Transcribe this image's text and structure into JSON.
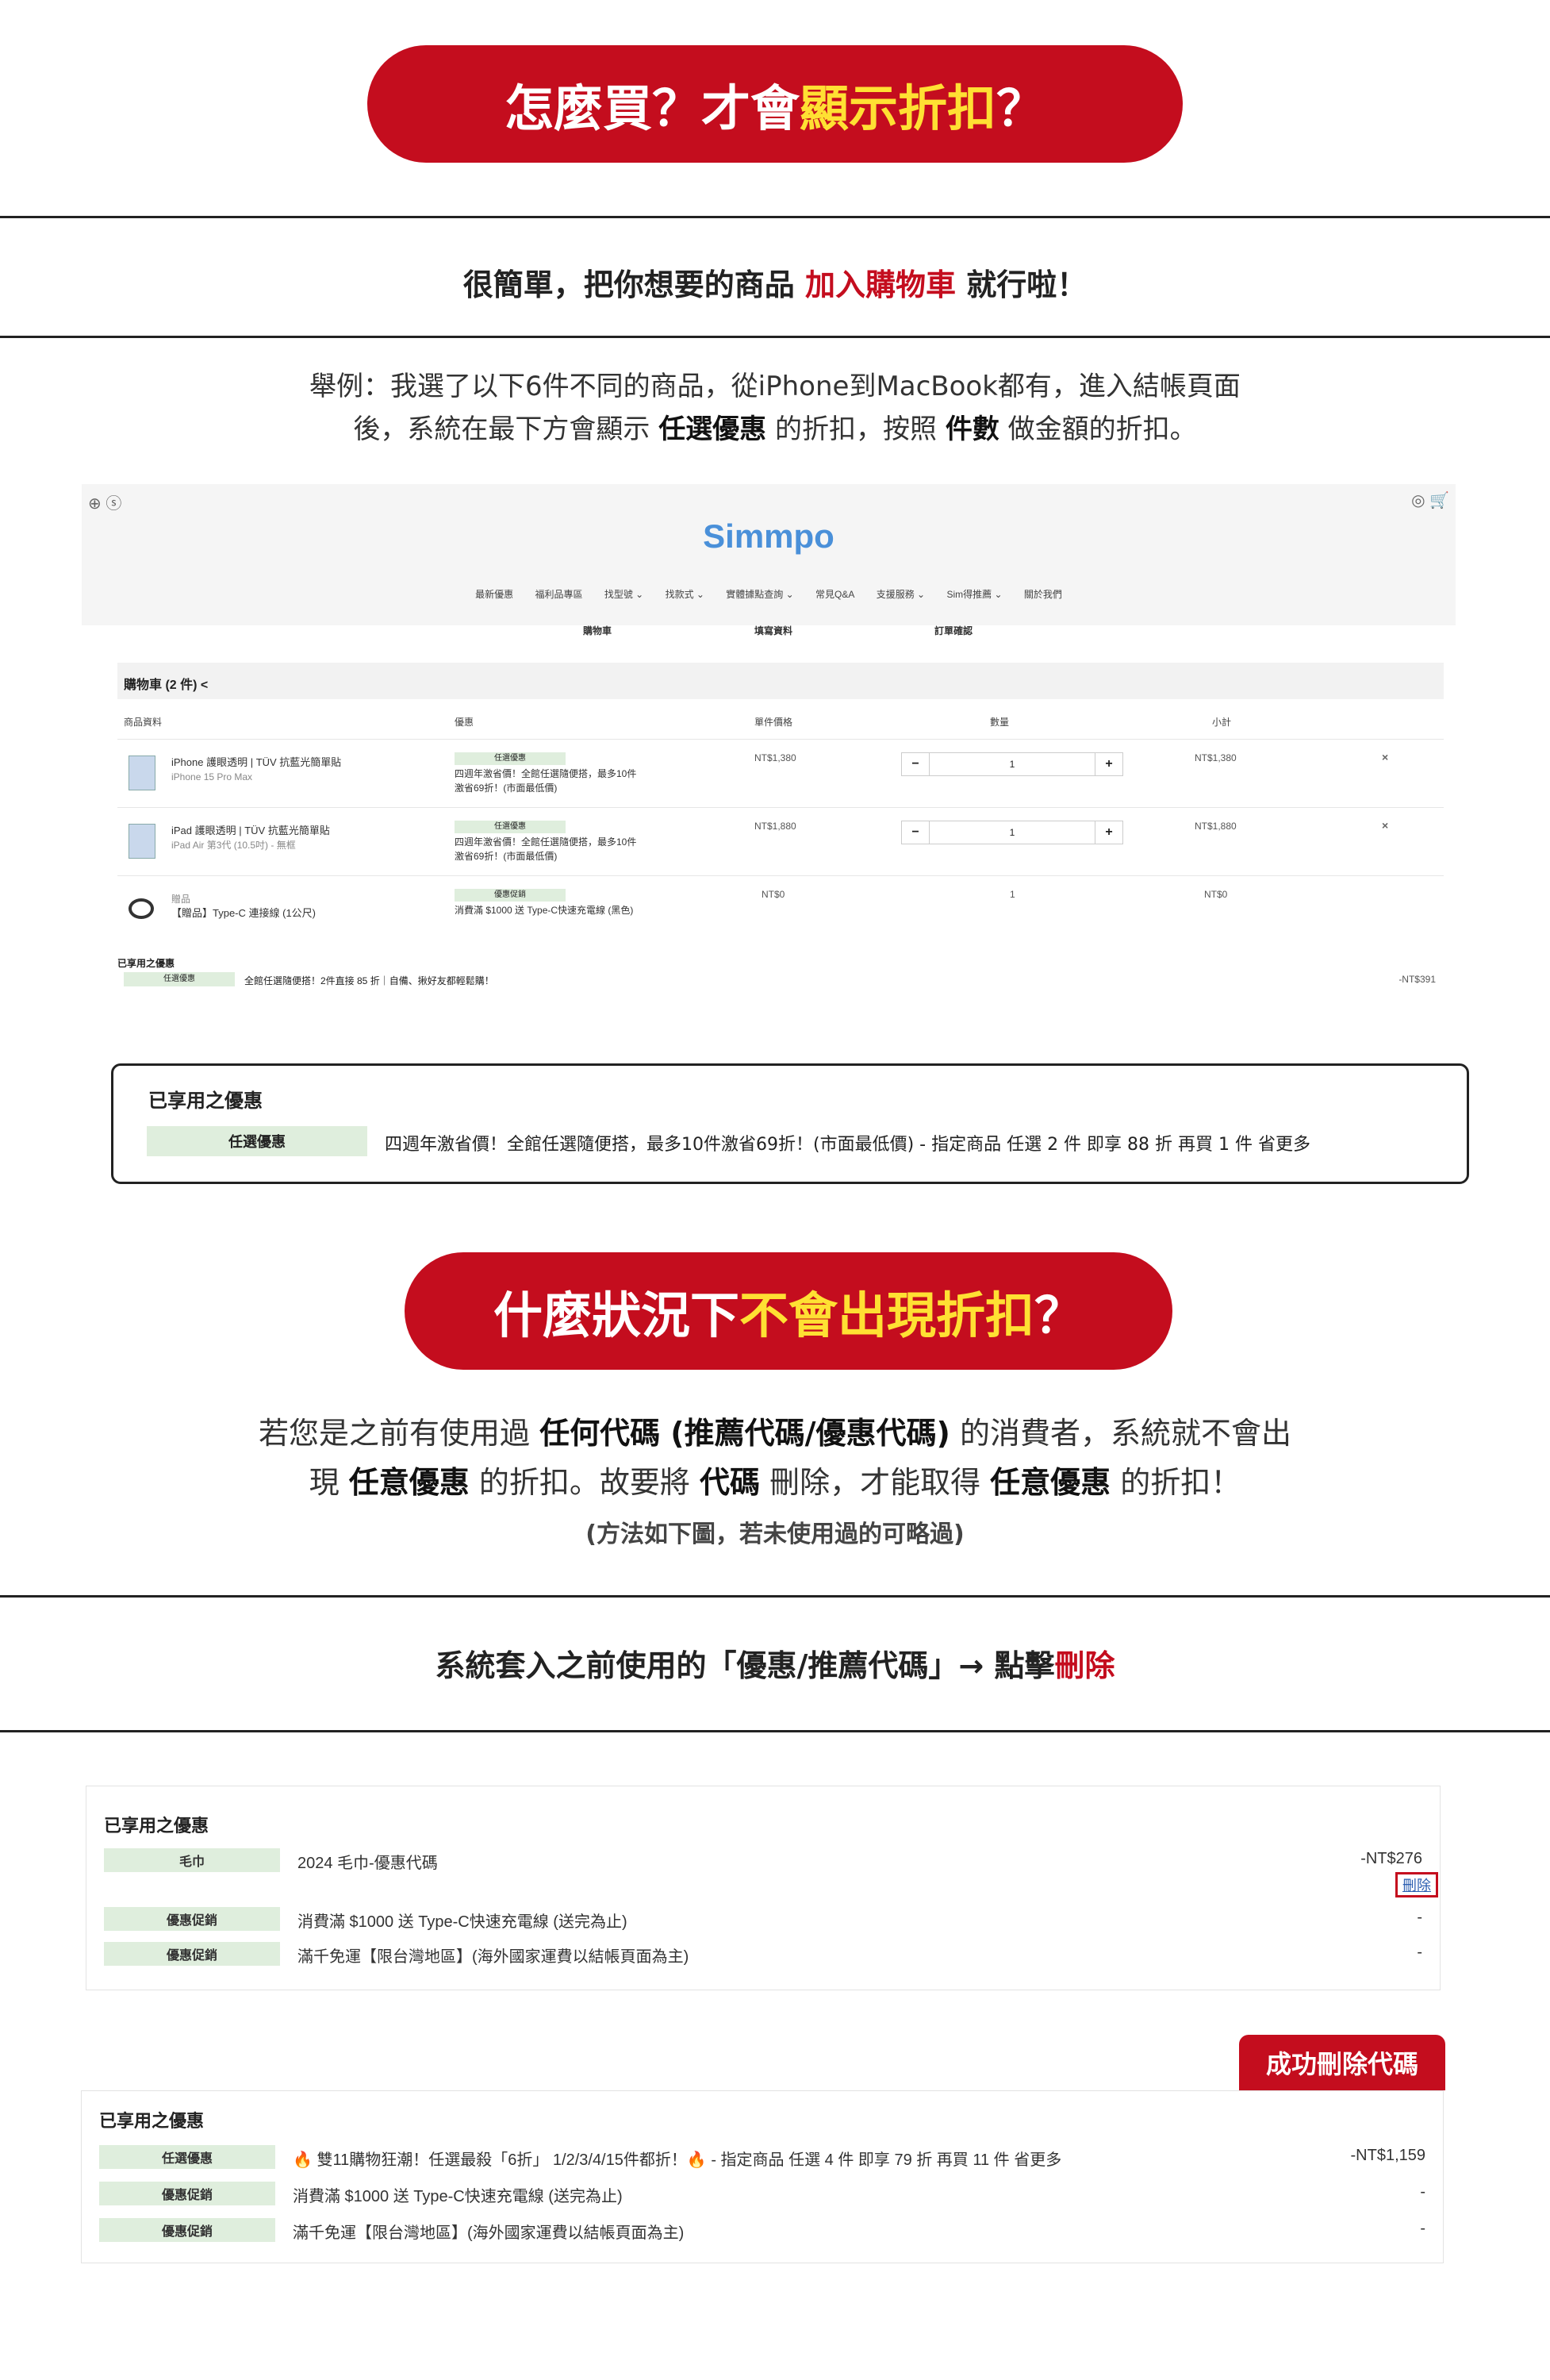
{
  "section1": {
    "pill_text": "怎麼買？才會 ",
    "pill_highlight": "顯示折扣",
    "pill_end": "？",
    "subtitle_prefix": "很簡單，把你想要的商品 ",
    "subtitle_red": "加入購物車",
    "subtitle_suffix": " 就行啦！",
    "para_line1": "舉例：我選了以下6件不同的商品，從iPhone到MacBook都有，進入結帳頁面",
    "para_line2_a": "後，系統在最下方會顯示 ",
    "para_line2_b": "任選優惠",
    "para_line2_c": " 的折扣，按照 ",
    "para_line2_d": "件數",
    "para_line2_e": " 做金額的折扣。"
  },
  "shot1": {
    "logo": "Simmpo",
    "nav": [
      "最新優惠",
      "福利品專區",
      "找型號 ⌄",
      "找款式 ⌄",
      "實體據點查詢 ⌄",
      "常見Q&A",
      "支援服務 ⌄",
      "Sim得推薦 ⌄",
      "關於我們"
    ],
    "steps": [
      "購物車",
      "填寫資料",
      "訂單確認"
    ],
    "cart_title": "購物車  (2 件)  <",
    "col_headers": [
      "商品資料",
      "優惠",
      "單件價格",
      "數量",
      "小計"
    ],
    "rows": [
      {
        "name": "iPhone 護眼透明 | TÜV 抗藍光簡單貼",
        "sub": "iPhone 15 Pro Max",
        "tag": "任選優惠",
        "promo1": "四週年激省價！全館任選隨便搭，最多10件",
        "promo2": "激省69折！(市面最低價)",
        "price": "NT$1,380",
        "qty": "1",
        "subtotal": "NT$1,380",
        "minus": "−",
        "plus": "+",
        "remove": "×"
      },
      {
        "name": "iPad 護眼透明 | TÜV 抗藍光簡單貼",
        "sub": "iPad Air 第3代 (10.5吋) - 無框",
        "tag": "任選優惠",
        "promo1": "四週年激省價！全館任選隨便搭，最多10件",
        "promo2": "激省69折！(市面最低價)",
        "price": "NT$1,880",
        "qty": "1",
        "subtotal": "NT$1,880",
        "minus": "−",
        "plus": "+",
        "remove": "×"
      },
      {
        "name": "【贈品】Type-C 連接線 (1公尺)",
        "sub": "贈品",
        "tag": "優惠促銷",
        "promo1": "消費滿 $1000 送 Type-C快速充電線 (黑色)",
        "promo2": "",
        "price": "NT$0",
        "qty": "1",
        "subtotal": "NT$0"
      }
    ],
    "used_title": "已享用之優惠",
    "used_tag": "任選優惠",
    "used_text": "全館任選隨便搭！2件直接 85 折｜自備、揪好友都輕鬆購！",
    "used_amount": "-NT$391"
  },
  "box": {
    "title": "已享用之優惠",
    "tag": "任選優惠",
    "desc": "四週年激省價！全館任選隨便搭，最多10件激省69折！(市面最低價) - 指定商品 任選 2 件 即享 88 折 再買 1 件 省更多"
  },
  "section2": {
    "pill_text": "什麼狀況下 ",
    "pill_highlight": "不會出現折扣",
    "pill_end": "？",
    "para1_a": "若您是之前有使用過 ",
    "para1_b": "任何代碼 (推薦代碼/優惠代碼)",
    "para1_c": " 的消費者，系統就不會出",
    "para2_a": "現 ",
    "para2_b": "任意優惠",
    "para2_c": " 的折扣。故要將 ",
    "para2_d": "代碼",
    "para2_e": " 刪除，才能取得 ",
    "para2_f": "任意優惠",
    "para2_g": " 的折扣！",
    "note": "(方法如下圖，若未使用過的可略過)",
    "bar_prefix": "系統套入之前使用的「優惠/推薦代碼」→ 點擊",
    "bar_red": "刪除"
  },
  "shot2": {
    "title": "已享用之優惠",
    "rows": [
      {
        "tag": "毛巾",
        "text": "2024 毛巾-優惠代碼",
        "amount": "-NT$276"
      },
      {
        "tag": "優惠促銷",
        "text": "消費滿 $1000 送 Type-C快速充電線 (送完為止)",
        "amount": "-"
      },
      {
        "tag": "優惠促銷",
        "text": "滿千免運【限台灣地區】(海外國家運費以結帳頁面為主)",
        "amount": "-"
      }
    ],
    "delete_label": "刪除"
  },
  "success_label": "成功刪除代碼",
  "shot3": {
    "title": "已享用之優惠",
    "rows": [
      {
        "tag": "任選優惠",
        "text": "🔥 雙11購物狂潮！任選最殺「6折」 1/2/3/4/15件都折！🔥 - 指定商品 任選 4 件 即享 79 折 再買 11 件 省更多",
        "amount": "-NT$1,159"
      },
      {
        "tag": "優惠促銷",
        "text": "消費滿 $1000 送 Type-C快速充電線 (送完為止)",
        "amount": "-"
      },
      {
        "tag": "優惠促銷",
        "text": "滿千免運【限台灣地區】(海外國家運費以結帳頁面為主)",
        "amount": "-"
      }
    ]
  },
  "colors": {
    "brand_red": "#c40d1e",
    "highlight_yellow": "#ffe033",
    "tag_green": "#dfeedd"
  }
}
